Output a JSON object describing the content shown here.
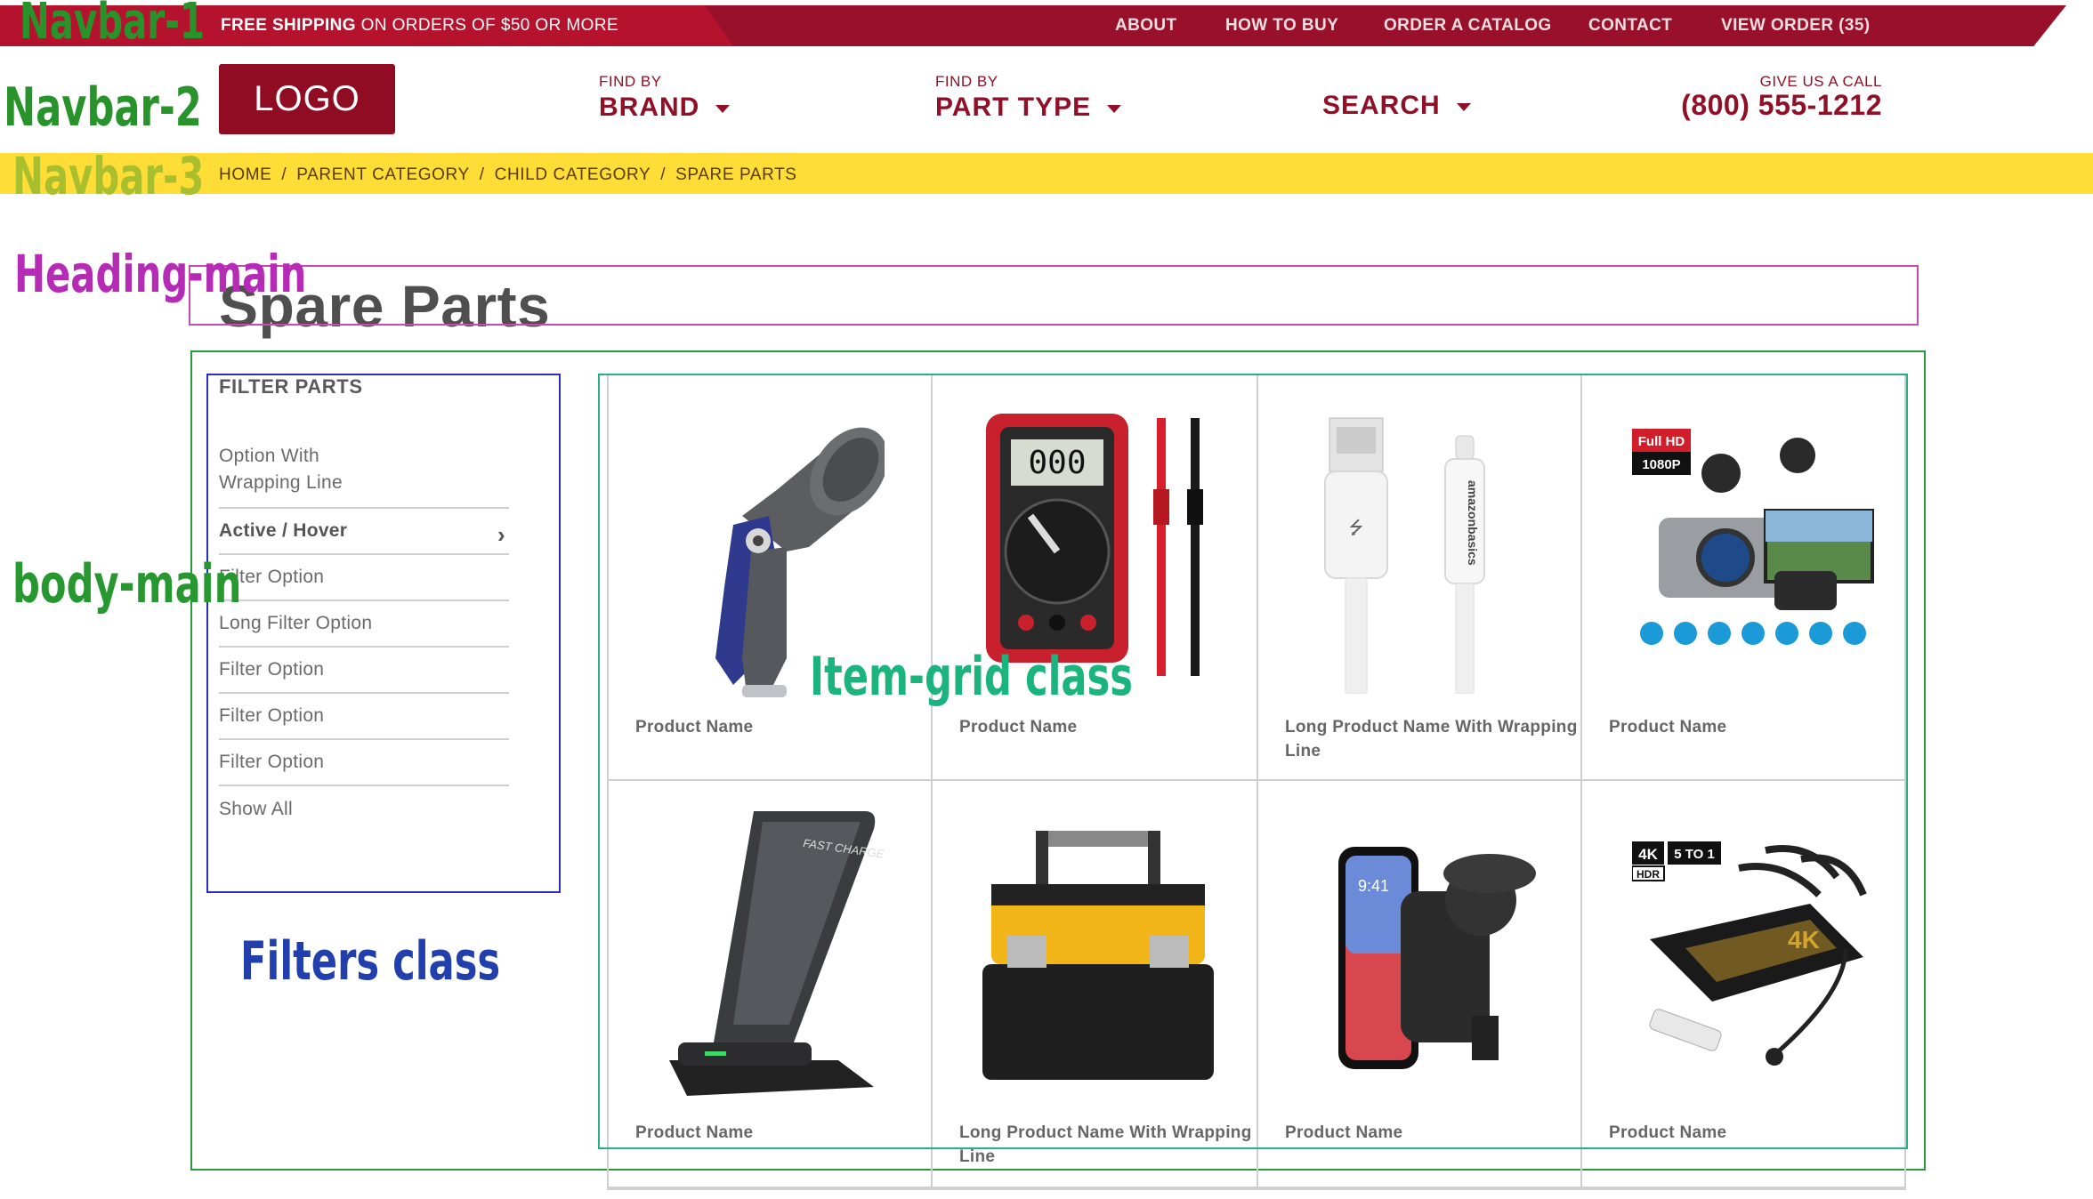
{
  "annotations": {
    "navbar1": "Navbar-1",
    "navbar2": "Navbar-2",
    "navbar3": "Navbar-3",
    "heading": "Heading-main",
    "body": "body-main",
    "grid": "Item-grid class",
    "filters": "Filters class"
  },
  "topbar": {
    "promo_bold": "FREE SHIPPING",
    "promo_rest": "ON ORDERS OF $50 OR MORE",
    "links": [
      "ABOUT",
      "HOW TO BUY",
      "ORDER A CATALOG",
      "CONTACT",
      "VIEW ORDER (35)"
    ]
  },
  "header": {
    "logo": "LOGO",
    "brand_small": "FIND BY",
    "brand_big": "BRAND",
    "type_small": "FIND BY",
    "type_big": "PART TYPE",
    "search": "SEARCH",
    "call_small": "GIVE US A CALL",
    "phone": "(800) 555-1212"
  },
  "breadcrumb": [
    "HOME",
    "PARENT CATEGORY",
    "CHILD CATEGORY",
    "SPARE PARTS"
  ],
  "page_title": "Spare Parts",
  "filters": {
    "heading": "FILTER PARTS",
    "items": [
      "Option With Wrapping Line",
      "Active / Hover",
      "Filter Option",
      "Long Filter Option",
      "Filter Option",
      "Filter Option",
      "Filter Option",
      "Show All"
    ]
  },
  "products": [
    {
      "name": "Product Name",
      "icon": "spray-nozzle-icon"
    },
    {
      "name": "Product Name",
      "icon": "multimeter-icon"
    },
    {
      "name": "Long Product Name With Wrapping Line",
      "icon": "usb-cable-icon"
    },
    {
      "name": "Product Name",
      "icon": "dash-cam-icon"
    },
    {
      "name": "Product Name",
      "icon": "wireless-charger-icon"
    },
    {
      "name": "Long Product Name With Wrapping Line",
      "icon": "tool-box-icon"
    },
    {
      "name": "Product Name",
      "icon": "phone-mount-icon"
    },
    {
      "name": "Product Name",
      "icon": "hdmi-switch-icon"
    }
  ],
  "image_text": {
    "multimeter_display": "000",
    "dashcam_badge1": "Full HD",
    "dashcam_badge2": "1080P",
    "charger_label": "FAST CHARGE",
    "cable_brand": "amazonbasics",
    "phone_time": "9:41",
    "hdmi_badge1": "4K",
    "hdmi_badge2": "5 TO 1",
    "hdmi_badge3": "HDR",
    "hdmi_label": "4K"
  },
  "colors": {
    "brand": "#98102a",
    "topbar": "#b5122e",
    "breadcrumb_bar": "#fedd36"
  }
}
